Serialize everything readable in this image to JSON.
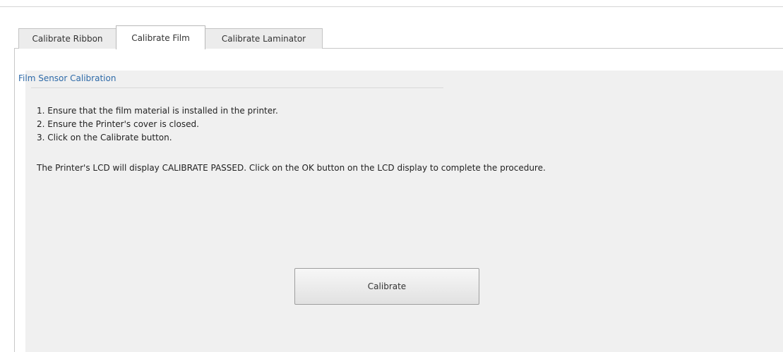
{
  "tabs": [
    {
      "label": "Calibrate Ribbon",
      "selected": false
    },
    {
      "label": "Calibrate Film",
      "selected": true
    },
    {
      "label": "Calibrate Laminator",
      "selected": false
    }
  ],
  "section": {
    "title": "Film Sensor Calibration"
  },
  "instructions": {
    "steps": [
      "1. Ensure that the film material is installed in the printer.",
      "2. Ensure the Printer's cover is closed.",
      "3. Click on the Calibrate button."
    ],
    "note": "The Printer's LCD will display CALIBRATE PASSED.  Click on the OK button on the LCD display to complete the procedure."
  },
  "actions": {
    "calibrate_label": "Calibrate"
  }
}
